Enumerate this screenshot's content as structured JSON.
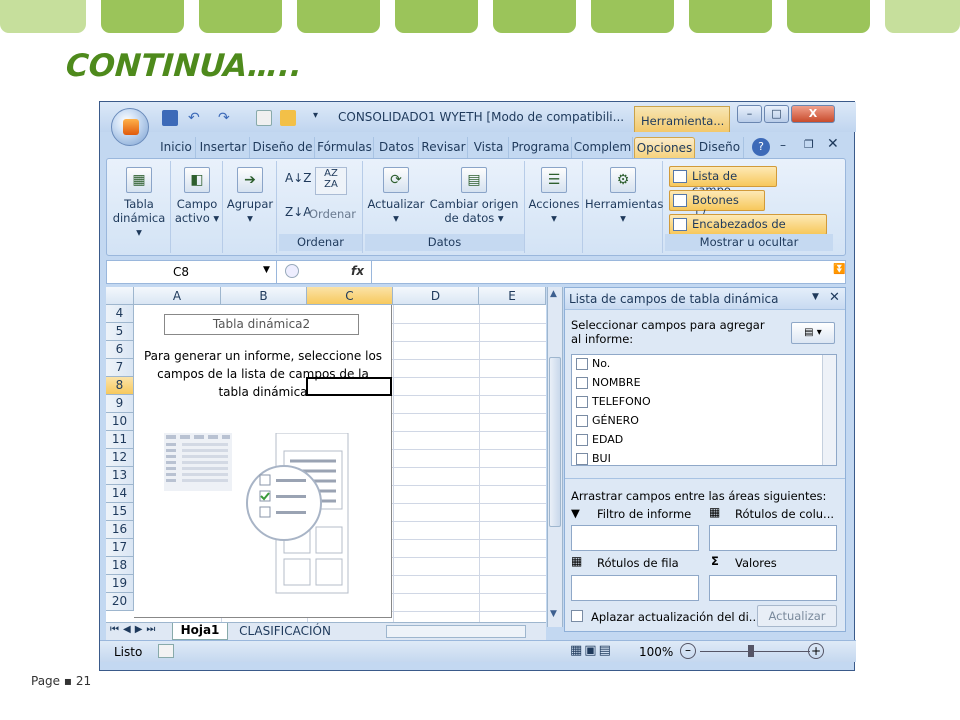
{
  "slide": {
    "title": "CONTINUA…..",
    "page_label": "Page",
    "page_number": "21"
  },
  "window": {
    "title": "CONSOLIDADO1 WYETH  [Modo de compatibili...",
    "tools_tab": "Herramienta...",
    "buttons": {
      "minimize": "–",
      "maximize": "□",
      "close": "X"
    }
  },
  "menu_tabs": [
    "Inicio",
    "Insertar",
    "Diseño de",
    "Fórmulas",
    "Datos",
    "Revisar",
    "Vista",
    "Programa",
    "Complem",
    "Opciones",
    "Diseño"
  ],
  "ribbon": {
    "pivot_table": "Tabla dinámica",
    "active_field": "Campo activo",
    "group": "Agrupar",
    "sort": "Ordenar",
    "sort_group": "Ordenar",
    "refresh": "Actualizar",
    "change_source": "Cambiar origen de datos",
    "data_group": "Datos",
    "actions": "Acciones",
    "tools": "Herramientas",
    "field_list": "Lista de campo",
    "buttons_toggle": "Botones +/-",
    "field_headers": "Encabezados de campo",
    "show_hide_group": "Mostrar u ocultar"
  },
  "formula_bar": {
    "name_box": "C8",
    "fx": "fx",
    "value": ""
  },
  "grid": {
    "columns": [
      "A",
      "B",
      "C",
      "D",
      "E"
    ],
    "rows": [
      "4",
      "5",
      "6",
      "7",
      "8",
      "9",
      "10",
      "11",
      "12",
      "13",
      "14",
      "15",
      "16",
      "17",
      "18",
      "19",
      "20"
    ],
    "selected_column": "C",
    "selected_row": "8"
  },
  "pivot_placeholder": {
    "name": "Tabla dinámica2",
    "line1": "Para generar un informe, seleccione los",
    "line2": "campos de la lista de campos de la",
    "line3": "tabla dinámica"
  },
  "sheet_tabs": [
    "Hoja1",
    "CLASIFICACIÓN"
  ],
  "status": {
    "ready": "Listo",
    "zoom": "100%"
  },
  "field_list": {
    "title": "Lista de campos de tabla dinámica",
    "instruction": "Seleccionar campos para agregar al informe:",
    "fields": [
      "No.",
      "NOMBRE",
      "TELEFONO",
      "GÉNERO",
      "EDAD",
      "BUI"
    ],
    "drag_label": "Arrastrar campos entre las áreas siguientes:",
    "report_filter": "Filtro de informe",
    "column_labels": "Rótulos de colu...",
    "row_labels": "Rótulos de fila",
    "values": "Valores",
    "defer_update": "Aplazar actualización del di...",
    "update_button": "Actualizar"
  },
  "colors": {
    "accent_green": "#9bc45a",
    "title_green": "#4e8a1c",
    "office_blue": "#c3d8f1",
    "highlight_orange": "#f7c85c"
  }
}
